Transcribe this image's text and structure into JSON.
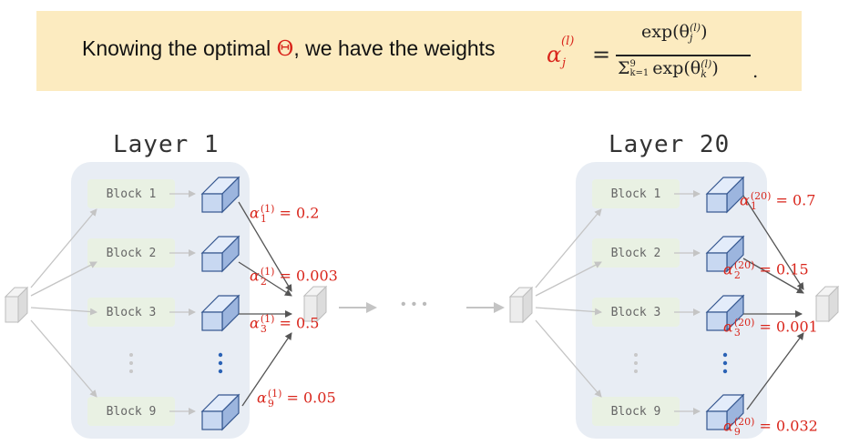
{
  "banner": {
    "text_before": "Knowing the optimal ",
    "theta": "Θ",
    "text_after": ", we have the weights",
    "formula": {
      "lhs": "α",
      "lhs_sub": "j",
      "lhs_sup": "(l)",
      "equals": "=",
      "numerator": "exp(θ",
      "num_sub": "j",
      "num_sup": "(l)",
      "num_close": ")",
      "den_sigma": "Σ",
      "den_sigma_sup": "9",
      "den_sigma_sub": "k=1",
      "den_exp": "exp(θ",
      "den_sub": "k",
      "den_sup": "(l)",
      "den_close": ")",
      "period": "."
    }
  },
  "layer1": {
    "title": "Layer 1",
    "blocks": [
      "Block 1",
      "Block 2",
      "Block 3",
      "Block 9"
    ],
    "weights": [
      {
        "sub": "1",
        "sup": "(1)",
        "value": "= 0.2"
      },
      {
        "sub": "2",
        "sup": "(1)",
        "value": "= 0.003"
      },
      {
        "sub": "3",
        "sup": "(1)",
        "value": "= 0.5"
      },
      {
        "sub": "9",
        "sup": "(1)",
        "value": "= 0.05"
      }
    ]
  },
  "layer20": {
    "title": "Layer 20",
    "blocks": [
      "Block 1",
      "Block 2",
      "Block 3",
      "Block 9"
    ],
    "weights": [
      {
        "sub": "1",
        "sup": "(20)",
        "value": "= 0.7"
      },
      {
        "sub": "2",
        "sup": "(20)",
        "value": "= 0.15"
      },
      {
        "sub": "3",
        "sup": "(20)",
        "value": "= 0.001"
      },
      {
        "sub": "9",
        "sup": "(20)",
        "value": "= 0.032"
      }
    ]
  },
  "alpha_symbol": "α",
  "ellipsis": "•••",
  "colors": {
    "banner_bg": "#fcebc0",
    "accent_red": "#d9261c",
    "panel_bg": "#e8edf4",
    "block_bg": "#e9f1e3",
    "cube_blue": "#c9d9f2",
    "cube_blue_edge": "#2e4f86",
    "cube_gray": "#eeeeee"
  }
}
